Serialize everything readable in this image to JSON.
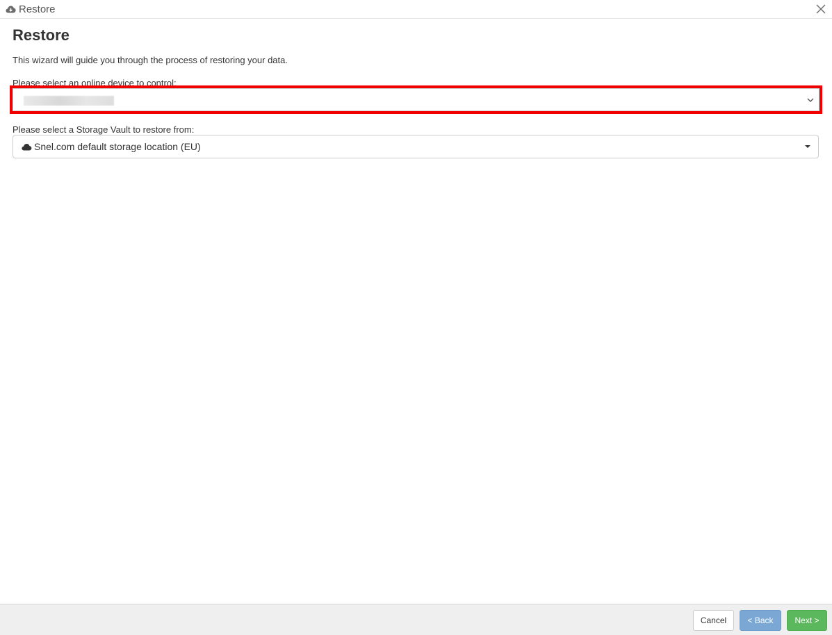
{
  "window": {
    "title": "Restore",
    "title_icon": "cloud-download-icon",
    "close_icon": "close-icon"
  },
  "page": {
    "heading": "Restore",
    "intro": "This wizard will guide you through the process of restoring your data."
  },
  "device_field": {
    "label": "Please select an online device to control:",
    "value": "",
    "highlight_color": "#f00000"
  },
  "vault_field": {
    "label": "Please select a Storage Vault to restore from:",
    "value": "Snel.com default storage location (EU)",
    "icon": "cloud-icon"
  },
  "footer": {
    "cancel_label": "Cancel",
    "back_label": "< Back",
    "next_label": "Next >",
    "back_color": "#7ba7d4",
    "next_color": "#5cb85c"
  }
}
